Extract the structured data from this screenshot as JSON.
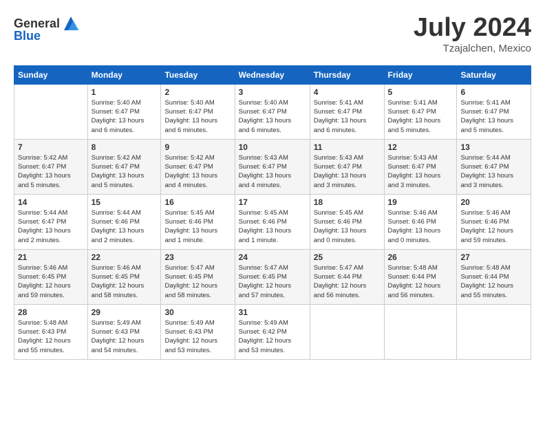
{
  "header": {
    "logo_general": "General",
    "logo_blue": "Blue",
    "month": "July 2024",
    "location": "Tzajalchen, Mexico"
  },
  "columns": [
    "Sunday",
    "Monday",
    "Tuesday",
    "Wednesday",
    "Thursday",
    "Friday",
    "Saturday"
  ],
  "weeks": [
    [
      {
        "day": "",
        "info": ""
      },
      {
        "day": "1",
        "info": "Sunrise: 5:40 AM\nSunset: 6:47 PM\nDaylight: 13 hours\nand 6 minutes."
      },
      {
        "day": "2",
        "info": "Sunrise: 5:40 AM\nSunset: 6:47 PM\nDaylight: 13 hours\nand 6 minutes."
      },
      {
        "day": "3",
        "info": "Sunrise: 5:40 AM\nSunset: 6:47 PM\nDaylight: 13 hours\nand 6 minutes."
      },
      {
        "day": "4",
        "info": "Sunrise: 5:41 AM\nSunset: 6:47 PM\nDaylight: 13 hours\nand 6 minutes."
      },
      {
        "day": "5",
        "info": "Sunrise: 5:41 AM\nSunset: 6:47 PM\nDaylight: 13 hours\nand 5 minutes."
      },
      {
        "day": "6",
        "info": "Sunrise: 5:41 AM\nSunset: 6:47 PM\nDaylight: 13 hours\nand 5 minutes."
      }
    ],
    [
      {
        "day": "7",
        "info": "Sunrise: 5:42 AM\nSunset: 6:47 PM\nDaylight: 13 hours\nand 5 minutes."
      },
      {
        "day": "8",
        "info": "Sunrise: 5:42 AM\nSunset: 6:47 PM\nDaylight: 13 hours\nand 5 minutes."
      },
      {
        "day": "9",
        "info": "Sunrise: 5:42 AM\nSunset: 6:47 PM\nDaylight: 13 hours\nand 4 minutes."
      },
      {
        "day": "10",
        "info": "Sunrise: 5:43 AM\nSunset: 6:47 PM\nDaylight: 13 hours\nand 4 minutes."
      },
      {
        "day": "11",
        "info": "Sunrise: 5:43 AM\nSunset: 6:47 PM\nDaylight: 13 hours\nand 3 minutes."
      },
      {
        "day": "12",
        "info": "Sunrise: 5:43 AM\nSunset: 6:47 PM\nDaylight: 13 hours\nand 3 minutes."
      },
      {
        "day": "13",
        "info": "Sunrise: 5:44 AM\nSunset: 6:47 PM\nDaylight: 13 hours\nand 3 minutes."
      }
    ],
    [
      {
        "day": "14",
        "info": "Sunrise: 5:44 AM\nSunset: 6:47 PM\nDaylight: 13 hours\nand 2 minutes."
      },
      {
        "day": "15",
        "info": "Sunrise: 5:44 AM\nSunset: 6:46 PM\nDaylight: 13 hours\nand 2 minutes."
      },
      {
        "day": "16",
        "info": "Sunrise: 5:45 AM\nSunset: 6:46 PM\nDaylight: 13 hours\nand 1 minute."
      },
      {
        "day": "17",
        "info": "Sunrise: 5:45 AM\nSunset: 6:46 PM\nDaylight: 13 hours\nand 1 minute."
      },
      {
        "day": "18",
        "info": "Sunrise: 5:45 AM\nSunset: 6:46 PM\nDaylight: 13 hours\nand 0 minutes."
      },
      {
        "day": "19",
        "info": "Sunrise: 5:46 AM\nSunset: 6:46 PM\nDaylight: 13 hours\nand 0 minutes."
      },
      {
        "day": "20",
        "info": "Sunrise: 5:46 AM\nSunset: 6:46 PM\nDaylight: 12 hours\nand 59 minutes."
      }
    ],
    [
      {
        "day": "21",
        "info": "Sunrise: 5:46 AM\nSunset: 6:45 PM\nDaylight: 12 hours\nand 59 minutes."
      },
      {
        "day": "22",
        "info": "Sunrise: 5:46 AM\nSunset: 6:45 PM\nDaylight: 12 hours\nand 58 minutes."
      },
      {
        "day": "23",
        "info": "Sunrise: 5:47 AM\nSunset: 6:45 PM\nDaylight: 12 hours\nand 58 minutes."
      },
      {
        "day": "24",
        "info": "Sunrise: 5:47 AM\nSunset: 6:45 PM\nDaylight: 12 hours\nand 57 minutes."
      },
      {
        "day": "25",
        "info": "Sunrise: 5:47 AM\nSunset: 6:44 PM\nDaylight: 12 hours\nand 56 minutes."
      },
      {
        "day": "26",
        "info": "Sunrise: 5:48 AM\nSunset: 6:44 PM\nDaylight: 12 hours\nand 56 minutes."
      },
      {
        "day": "27",
        "info": "Sunrise: 5:48 AM\nSunset: 6:44 PM\nDaylight: 12 hours\nand 55 minutes."
      }
    ],
    [
      {
        "day": "28",
        "info": "Sunrise: 5:48 AM\nSunset: 6:43 PM\nDaylight: 12 hours\nand 55 minutes."
      },
      {
        "day": "29",
        "info": "Sunrise: 5:49 AM\nSunset: 6:43 PM\nDaylight: 12 hours\nand 54 minutes."
      },
      {
        "day": "30",
        "info": "Sunrise: 5:49 AM\nSunset: 6:43 PM\nDaylight: 12 hours\nand 53 minutes."
      },
      {
        "day": "31",
        "info": "Sunrise: 5:49 AM\nSunset: 6:42 PM\nDaylight: 12 hours\nand 53 minutes."
      },
      {
        "day": "",
        "info": ""
      },
      {
        "day": "",
        "info": ""
      },
      {
        "day": "",
        "info": ""
      }
    ]
  ]
}
